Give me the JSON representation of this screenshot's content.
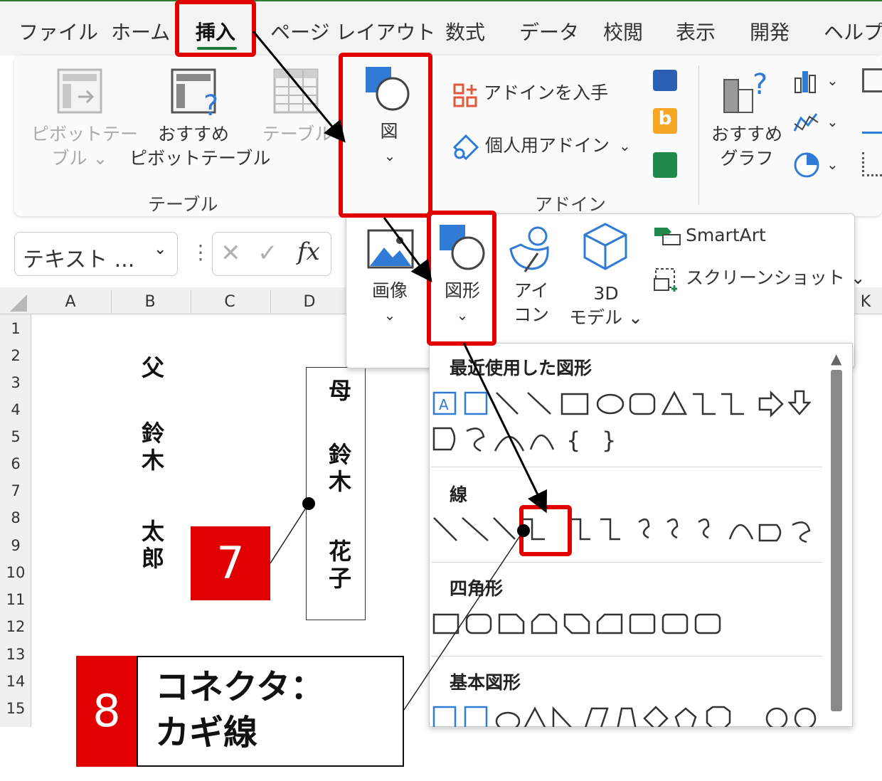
{
  "tabs": [
    "ファイル",
    "ホーム",
    "挿入",
    "ページ レイアウト",
    "数式",
    "データ",
    "校閲",
    "表示",
    "開発",
    "ヘルプ"
  ],
  "active_tab": "挿入",
  "ribbon": {
    "pivot_table": [
      "ピボットテー",
      "ブル ⌄"
    ],
    "recommended_pivot": [
      "おすすめ",
      "ピボットテーブル"
    ],
    "table": "テーブル",
    "group_table": "テーブル",
    "zu": "図",
    "get_addins": "アドインを入手",
    "personal_addins": "個人用アドイン",
    "group_addins": "アドイン",
    "recommended_charts": [
      "おすすめ",
      "グラフ"
    ]
  },
  "namebox": "テキスト ...",
  "fx": "fx",
  "columns": [
    "A",
    "B",
    "C",
    "D"
  ],
  "column_k": "K",
  "rows": [
    "1",
    "2",
    "3",
    "4",
    "5",
    "6",
    "7",
    "8",
    "9",
    "10",
    "11",
    "12",
    "13",
    "14",
    "15"
  ],
  "cells": {
    "father_label": "父",
    "father_name_1": "鈴木",
    "father_name_2": "太郎",
    "mother_label": "母",
    "mother_name_1": "鈴木",
    "mother_name_2": "花子"
  },
  "picture_menu": {
    "image": "画像",
    "shapes": "図形",
    "icons": [
      "アイ",
      "コン"
    ],
    "model_3d": [
      "3D",
      "モデル ⌄"
    ],
    "smartart": "SmartArt",
    "screenshot": "スクリーンショット ⌄"
  },
  "shape_menu": {
    "recent": "最近使用した図形",
    "lines": "線",
    "rectangles": "四角形",
    "basic": "基本図形"
  },
  "badges": {
    "step7": "7",
    "step8": "8"
  },
  "callout8": [
    "コネクタ：",
    "カギ線"
  ],
  "colors": {
    "highlight": "#e00000",
    "accent_green": "#1f7a3a",
    "icon_blue": "#2f7bd6"
  }
}
